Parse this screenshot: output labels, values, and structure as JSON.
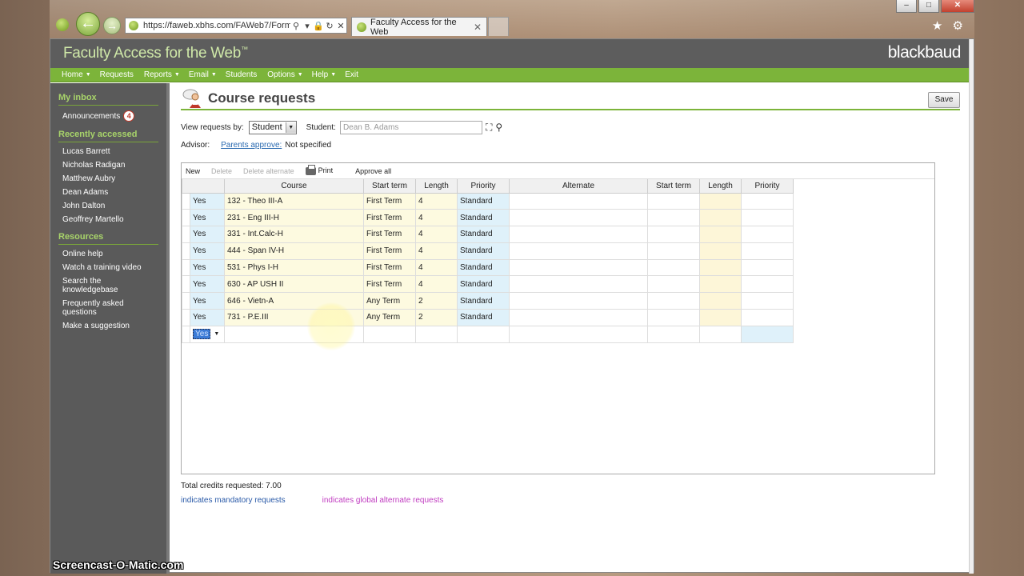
{
  "browser": {
    "url": "https://faweb.xbhs.com/FAWeb7/Form",
    "tab_title": "Faculty Access for the Web",
    "window_controls": [
      "minimize",
      "maximize",
      "close"
    ]
  },
  "header": {
    "app_title": "Faculty Access for the Web",
    "trademark": "™",
    "brand": "blackbaud"
  },
  "menu": [
    {
      "label": "Home",
      "has_caret": true
    },
    {
      "label": "Requests",
      "has_caret": false
    },
    {
      "label": "Reports",
      "has_caret": true
    },
    {
      "label": "Email",
      "has_caret": true
    },
    {
      "label": "Students",
      "has_caret": false
    },
    {
      "label": "Options",
      "has_caret": true
    },
    {
      "label": "Help",
      "has_caret": true
    },
    {
      "label": "Exit",
      "has_caret": false
    }
  ],
  "sidebar": {
    "inbox_heading": "My inbox",
    "announcements_label": "Announcements",
    "announcements_count": "4",
    "recent_heading": "Recently accessed",
    "recent": [
      "Lucas Barrett",
      "Nicholas Radigan",
      "Matthew Aubry",
      "Dean Adams",
      "John Dalton",
      "Geoffrey Martello"
    ],
    "resources_heading": "Resources",
    "resources": [
      "Online help",
      "Watch a training video",
      "Search the knowledgebase",
      "Frequently asked questions",
      "Make a suggestion"
    ]
  },
  "main": {
    "title": "Course requests",
    "save_label": "Save",
    "view_label": "View requests by:",
    "view_value": "Student",
    "student_label": "Student:",
    "student_placeholder": "Dean B. Adams",
    "advisor_label": "Advisor:",
    "parents_link": "Parents approve:",
    "parents_value": "Not specified"
  },
  "toolbar": {
    "new": "New",
    "delete": "Delete",
    "delete_alternate": "Delete alternate",
    "print": "Print",
    "approve_all": "Approve all"
  },
  "grid": {
    "columns": [
      "",
      "Course",
      "Start term",
      "Length",
      "Priority",
      "Alternate",
      "Start term",
      "Length",
      "Priority"
    ],
    "rows": [
      {
        "yes": "Yes",
        "course": "132 - Theo III-A",
        "term": "First Term",
        "length": "4",
        "priority": "Standard"
      },
      {
        "yes": "Yes",
        "course": "231 - Eng III-H",
        "term": "First Term",
        "length": "4",
        "priority": "Standard"
      },
      {
        "yes": "Yes",
        "course": "331 - Int.Calc-H",
        "term": "First Term",
        "length": "4",
        "priority": "Standard"
      },
      {
        "yes": "Yes",
        "course": "444 - Span IV-H",
        "term": "First Term",
        "length": "4",
        "priority": "Standard"
      },
      {
        "yes": "Yes",
        "course": "531 - Phys I-H",
        "term": "First Term",
        "length": "4",
        "priority": "Standard"
      },
      {
        "yes": "Yes",
        "course": "630 - AP USH II",
        "term": "First Term",
        "length": "4",
        "priority": "Standard"
      },
      {
        "yes": "Yes",
        "course": "646 - Vietn-A",
        "term": "Any Term",
        "length": "2",
        "priority": "Standard"
      },
      {
        "yes": "Yes",
        "course": "731 - P.E.III",
        "term": "Any Term",
        "length": "2",
        "priority": "Standard"
      }
    ],
    "new_row_value": "Yes"
  },
  "footer": {
    "total_credits": "Total credits requested: 7.00",
    "mandatory_legend": "indicates mandatory requests",
    "global_legend": "indicates global alternate requests"
  },
  "watermark": "Screencast-O-Matic.com",
  "colors": {
    "accent_green": "#7cb43a",
    "header_gray": "#5d5d5d",
    "mandatory_blue": "#2a5aa8",
    "global_magenta": "#c03cc0"
  }
}
